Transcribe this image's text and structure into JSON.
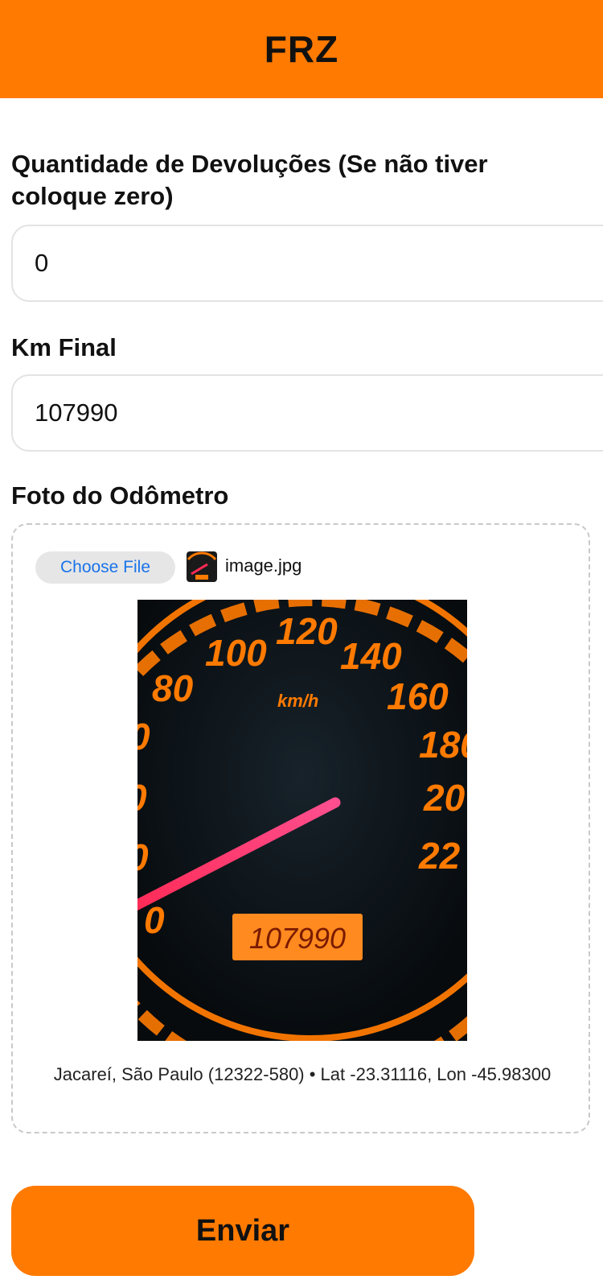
{
  "header": {
    "title": "FRZ"
  },
  "form": {
    "devolucoes": {
      "label": "Quantidade de Devoluções (Se não tiver coloque zero)",
      "value": "0"
    },
    "km_final": {
      "label": "Km Final",
      "value": "107990"
    },
    "foto": {
      "label": "Foto do Odômetro",
      "choose_file_label": "Choose File",
      "file_name": "image.jpg",
      "location": "Jacareí, São Paulo (12322-580) • Lat -23.31116, Lon -45.98300"
    }
  },
  "odometer_photo": {
    "speed_labels": [
      "0",
      "0",
      "0",
      "0",
      "80",
      "100",
      "120",
      "140",
      "160",
      "180",
      "20",
      "22"
    ],
    "unit": "km/h",
    "reading": "107990",
    "accent_color": "#ff7a00",
    "needle_color": "#ff2a55"
  },
  "submit": {
    "label": "Enviar"
  }
}
